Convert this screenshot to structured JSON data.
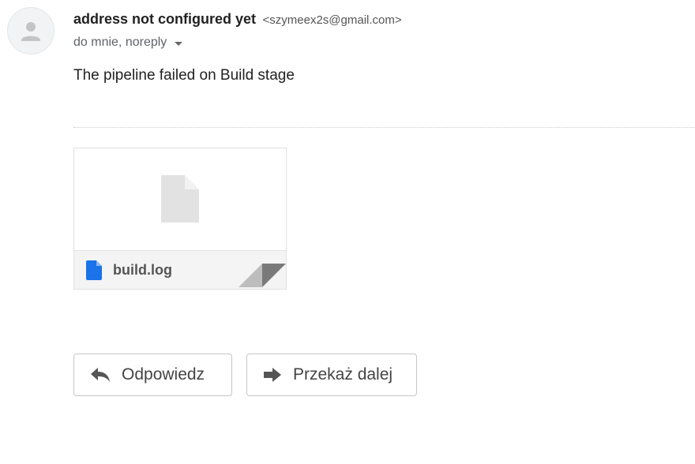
{
  "message": {
    "sender_name": "address not configured yet",
    "sender_email": "<szymeex2s@gmail.com>",
    "recipients": "do mnie, noreply",
    "body": "The pipeline failed on Build stage"
  },
  "attachment": {
    "filename": "build.log",
    "file_icon_color": "#1a73e8"
  },
  "actions": {
    "reply_label": "Odpowiedz",
    "forward_label": "Przekaż dalej"
  },
  "icons": {
    "avatar": "person-icon",
    "recipients_toggle": "chevron-down-icon",
    "attachment_preview": "file-icon",
    "attachment_type": "document-icon",
    "reply": "reply-arrow-icon",
    "forward": "forward-arrow-icon"
  }
}
